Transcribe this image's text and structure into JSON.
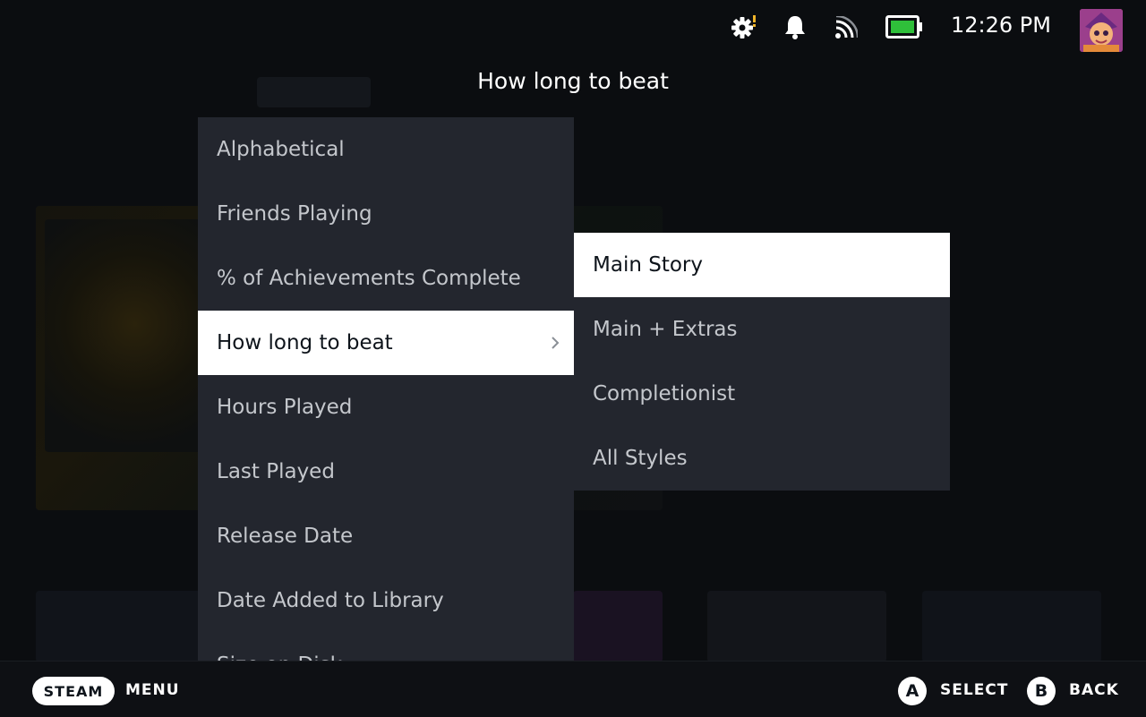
{
  "status_bar": {
    "time": "12:26 PM",
    "icons": [
      "settings-alert-icon",
      "bell-icon",
      "wifi-icon",
      "battery-icon"
    ],
    "battery_color": "#2fbf3a"
  },
  "menu": {
    "title": "How long to beat",
    "items": [
      {
        "label": "Alphabetical"
      },
      {
        "label": "Friends Playing"
      },
      {
        "label": "% of Achievements Complete"
      },
      {
        "label": "How long to beat"
      },
      {
        "label": "Hours Played"
      },
      {
        "label": "Last Played"
      },
      {
        "label": "Release Date"
      },
      {
        "label": "Date Added to Library"
      },
      {
        "label": "Size on Disk"
      }
    ],
    "selected_index": 3
  },
  "submenu": {
    "items": [
      {
        "label": "Main Story"
      },
      {
        "label": "Main + Extras"
      },
      {
        "label": "Completionist"
      },
      {
        "label": "All Styles"
      }
    ],
    "selected_index": 0
  },
  "footer": {
    "steam_label": "STEAM",
    "menu_label": "MENU",
    "a_glyph": "A",
    "select_label": "SELECT",
    "b_glyph": "B",
    "back_label": "BACK"
  },
  "colors": {
    "menu_bg": "#23262e",
    "selected_bg": "#ffffff",
    "page_bg": "#0b0d10"
  }
}
